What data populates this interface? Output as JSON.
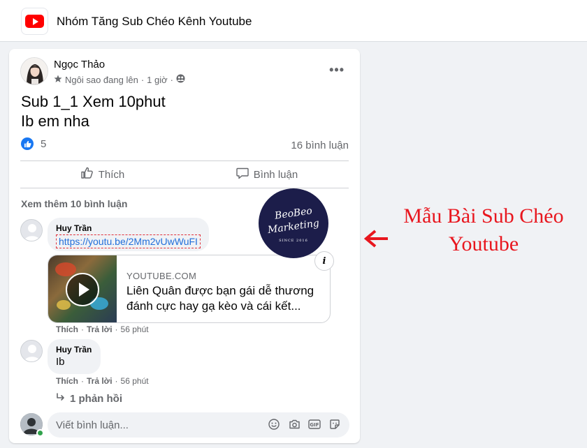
{
  "header": {
    "group_title": "Nhóm Tăng Sub Chéo Kênh Youtube",
    "logo_icon": "youtube-icon"
  },
  "post": {
    "author": "Ngọc Thảo",
    "badge": "Ngôi sao đang lên",
    "separator": "·",
    "time": "1 giờ",
    "audience_icon": "group-icon",
    "text_line1": "Sub 1_1 Xem 10phut",
    "text_line2": "Ib em nha",
    "reaction_count": "5",
    "comment_count": "16 bình luận",
    "like_label": "Thích",
    "comment_label": "Bình luận"
  },
  "comments": {
    "see_more": "Xem thêm 10 bình luận",
    "items": [
      {
        "name": "Huy Trần",
        "link": "https://youtu.be/2Mm2vUwWuFI",
        "preview_domain": "YOUTUBE.COM",
        "preview_title": "Liên Quân được bạn gái dễ thương đánh cực hay gạ kèo và cái kết...",
        "like": "Thích",
        "dot": "·",
        "reply": "Trả lời",
        "time": "56 phút"
      },
      {
        "name": "Huy Trần",
        "text": "Ib",
        "like": "Thích",
        "dot": "·",
        "reply": "Trả lời",
        "time": "56 phút"
      }
    ],
    "replies_label": "1 phản hồi",
    "input_placeholder": "Viết bình luận..."
  },
  "watermark": {
    "line1": "BeoBeo",
    "line2": "Marketing",
    "line3": "SINCE 2016"
  },
  "annotation": {
    "line1": "Mẫu Bài Sub Chéo",
    "line2": "Youtube",
    "color": "#e8161e"
  },
  "colors": {
    "accent": "#1877f2",
    "link": "#216fdb",
    "muted": "#65676b",
    "online": "#31a24c"
  }
}
